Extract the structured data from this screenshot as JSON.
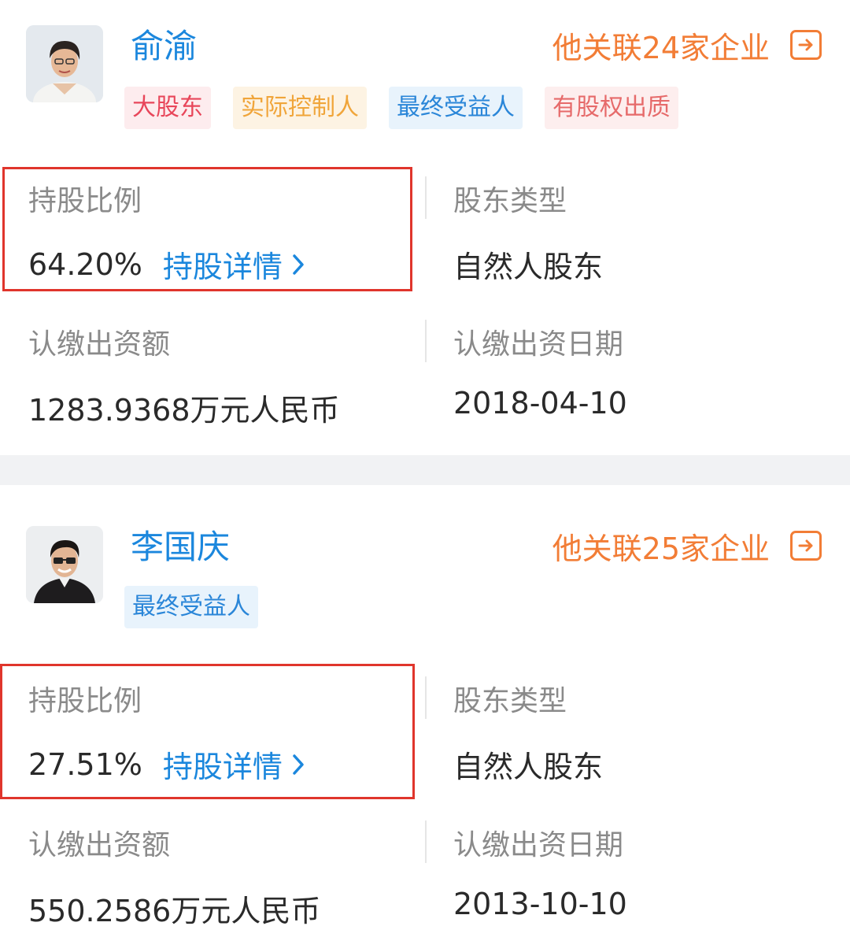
{
  "shareholders": [
    {
      "name": "俞渝",
      "related_companies": "他关联24家企业",
      "tags": [
        "大股东",
        "实际控制人",
        "最终受益人",
        "有股权出质"
      ],
      "share_ratio_label": "持股比例",
      "share_ratio_value": "64.20%",
      "share_detail_link": "持股详情",
      "holder_type_label": "股东类型",
      "holder_type_value": "自然人股东",
      "subscribed_capital_label": "认缴出资额",
      "subscribed_capital_value": "1283.9368万元人民币",
      "subscribed_date_label": "认缴出资日期",
      "subscribed_date_value": "2018-04-10"
    },
    {
      "name": "李国庆",
      "related_companies": "他关联25家企业",
      "tags": [
        "最终受益人"
      ],
      "share_ratio_label": "持股比例",
      "share_ratio_value": "27.51%",
      "share_detail_link": "持股详情",
      "holder_type_label": "股东类型",
      "holder_type_value": "自然人股东",
      "subscribed_capital_label": "认缴出资额",
      "subscribed_capital_value": "550.2586万元人民币",
      "subscribed_date_label": "认缴出资日期",
      "subscribed_date_value": "2013-10-10"
    }
  ],
  "icons": {
    "related_arrow": "arrow-right-boxed-icon",
    "detail_chevron": "chevron-right-icon"
  },
  "colors": {
    "name_blue": "#1b87dd",
    "related_orange": "#f27d36",
    "highlight_red": "#e0352c"
  }
}
